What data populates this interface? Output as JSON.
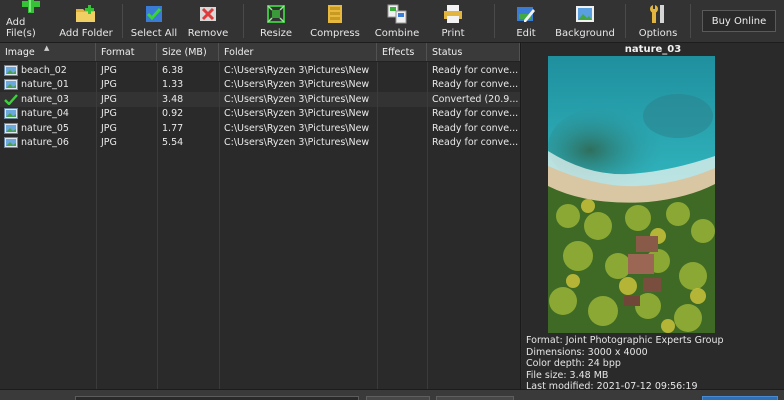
{
  "toolbar": {
    "add_files": "Add File(s)",
    "add_folder": "Add Folder",
    "select_all": "Select All",
    "remove": "Remove",
    "resize": "Resize",
    "compress": "Compress",
    "combine": "Combine",
    "print": "Print",
    "edit": "Edit",
    "background": "Background",
    "options": "Options",
    "buy_online": "Buy Online"
  },
  "table": {
    "columns": [
      "Image",
      "Format",
      "Size (MB)",
      "Folder",
      "Effects",
      "Status"
    ],
    "rows": [
      {
        "image": "beach_02",
        "format": "JPG",
        "size": "6.38",
        "folder": "C:\\Users\\Ryzen 3\\Pictures\\New",
        "effects": "",
        "status": "Ready for conve...",
        "converted": false
      },
      {
        "image": "nature_01",
        "format": "JPG",
        "size": "1.33",
        "folder": "C:\\Users\\Ryzen 3\\Pictures\\New",
        "effects": "",
        "status": "Ready for conve...",
        "converted": false
      },
      {
        "image": "nature_03",
        "format": "JPG",
        "size": "3.48",
        "folder": "C:\\Users\\Ryzen 3\\Pictures\\New",
        "effects": "",
        "status": "Converted (20.9...",
        "converted": true
      },
      {
        "image": "nature_04",
        "format": "JPG",
        "size": "0.92",
        "folder": "C:\\Users\\Ryzen 3\\Pictures\\New",
        "effects": "",
        "status": "Ready for conve...",
        "converted": false
      },
      {
        "image": "nature_05",
        "format": "JPG",
        "size": "1.77",
        "folder": "C:\\Users\\Ryzen 3\\Pictures\\New",
        "effects": "",
        "status": "Ready for conve...",
        "converted": false
      },
      {
        "image": "nature_06",
        "format": "JPG",
        "size": "5.54",
        "folder": "C:\\Users\\Ryzen 3\\Pictures\\New",
        "effects": "",
        "status": "Ready for conve...",
        "converted": false
      }
    ]
  },
  "preview": {
    "title": "nature_03",
    "format": "Format: Joint Photographic Experts Group",
    "dimensions": "Dimensions: 3000 x 4000",
    "color_depth": "Color depth: 24 bpp",
    "file_size": "File size: 3.48 MB",
    "last_modified": "Last modified: 2021-07-12 09:56:19"
  },
  "icons": {
    "add_files": "plus-icon",
    "add_folder": "folder-plus-icon",
    "select_all": "checklist-icon",
    "remove": "remove-icon",
    "resize": "resize-icon",
    "compress": "compress-icon",
    "combine": "combine-icon",
    "print": "print-icon",
    "edit": "edit-icon",
    "background": "background-icon",
    "options": "wrench-icon",
    "file": "image-file-icon",
    "converted": "check-icon"
  },
  "colors": {
    "accent_green": "#3fcf3f",
    "status_blue": "#2f6fb5",
    "background": "#2d2d2d"
  }
}
